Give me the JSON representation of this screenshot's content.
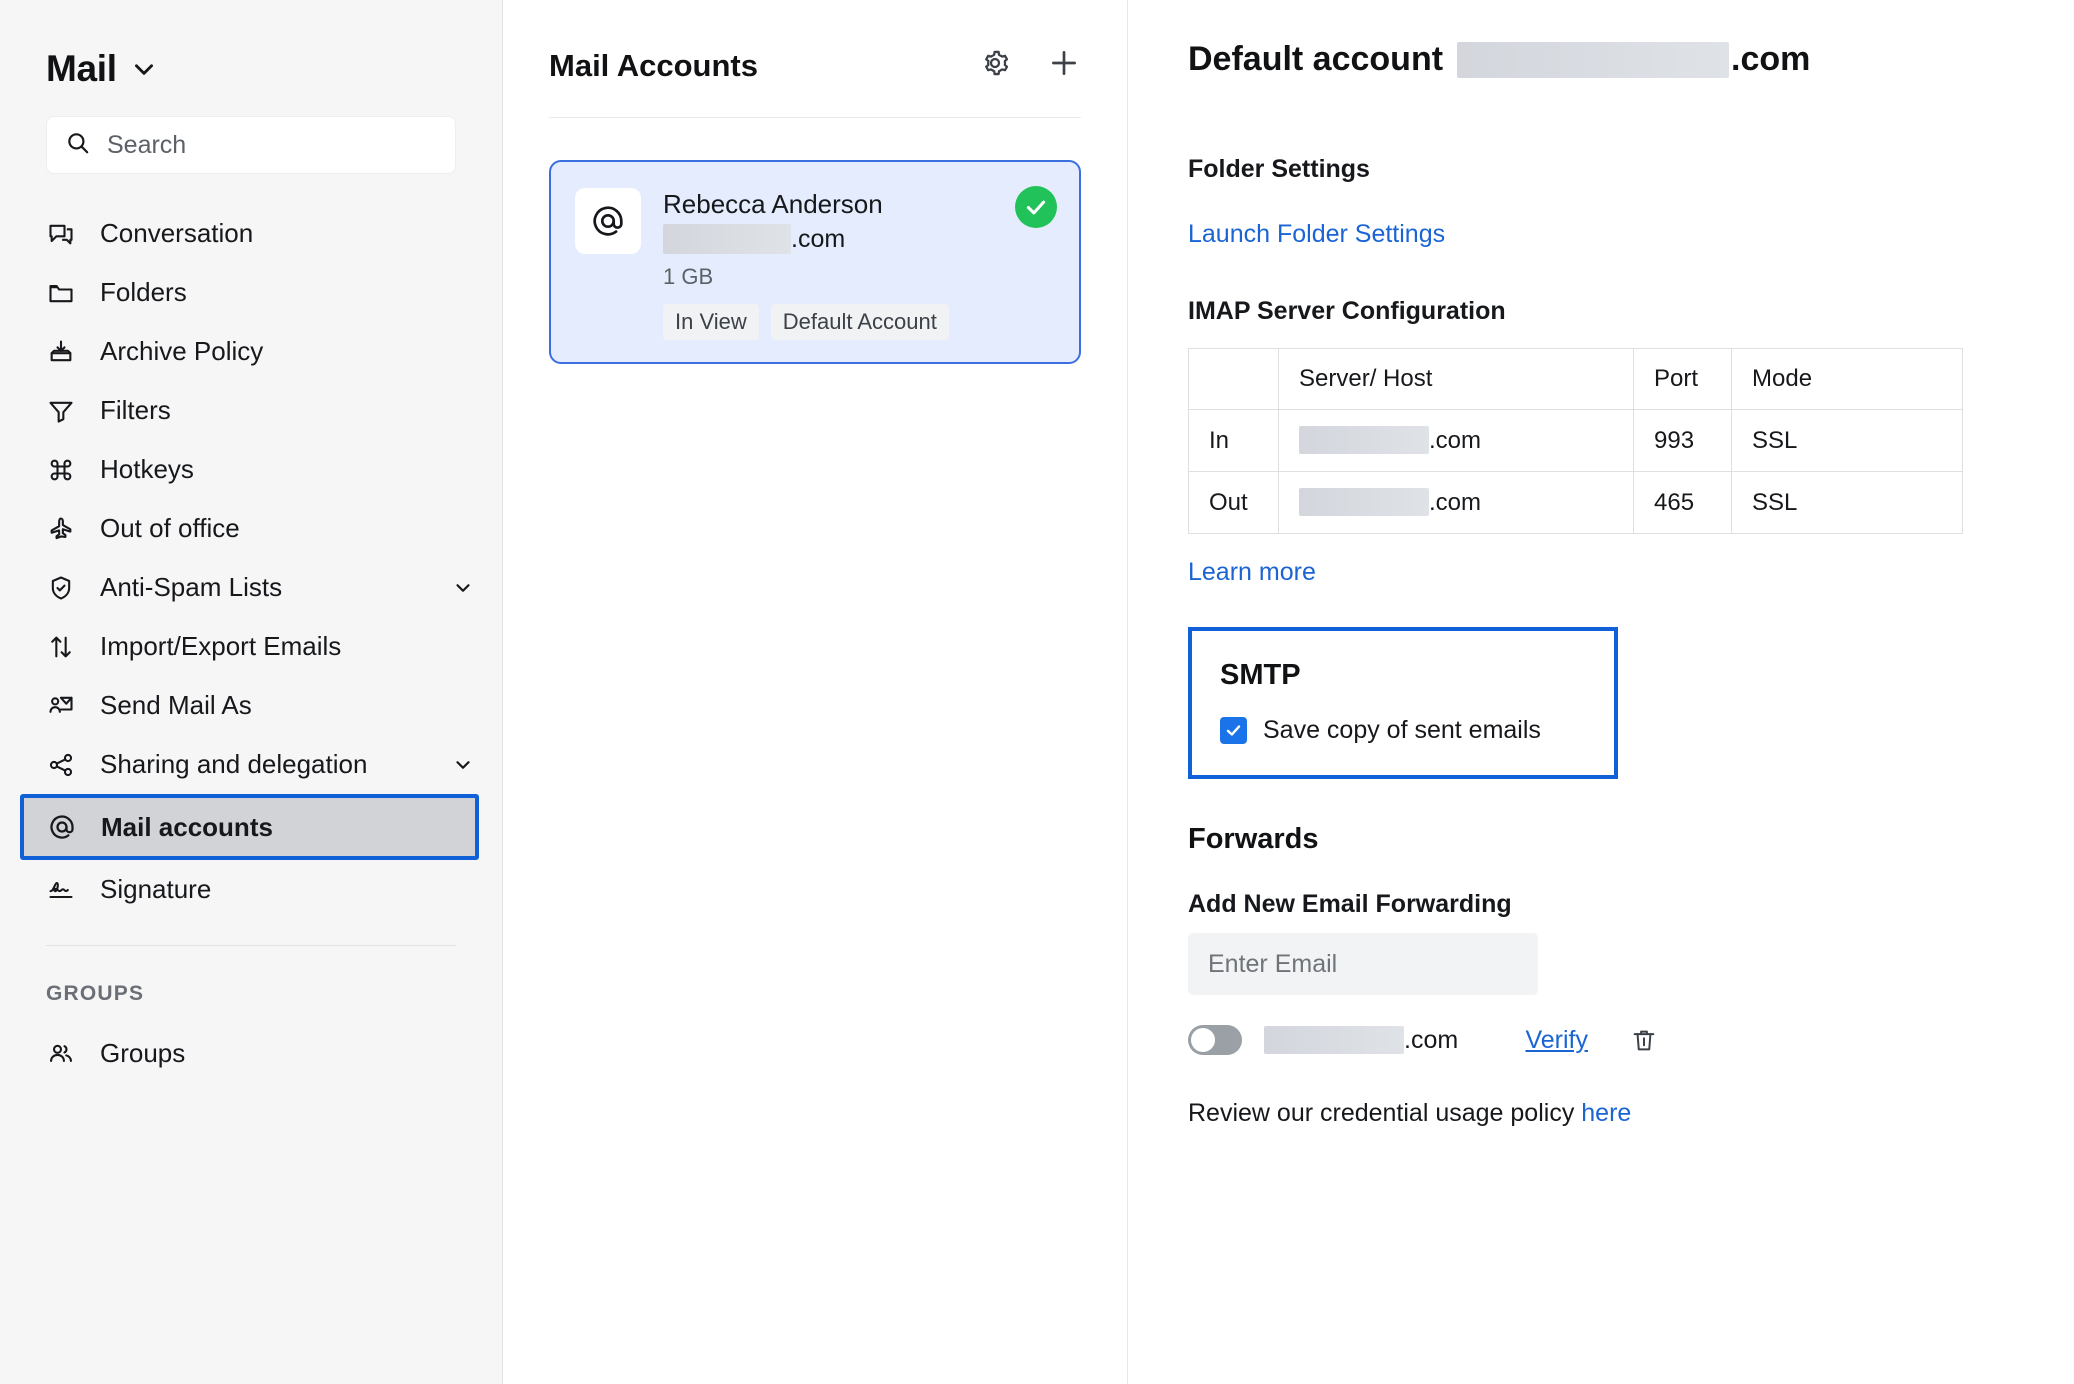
{
  "sidebar": {
    "brand": {
      "title": "Mail",
      "chevron_icon": "chevron-down-icon"
    },
    "search": {
      "placeholder": "Search",
      "icon": "search-icon"
    },
    "items": [
      {
        "label": "Conversation",
        "icon": "conversation-icon",
        "expandable": false
      },
      {
        "label": "Folders",
        "icon": "folder-icon",
        "expandable": false
      },
      {
        "label": "Archive Policy",
        "icon": "archive-icon",
        "expandable": false
      },
      {
        "label": "Filters",
        "icon": "filter-icon",
        "expandable": false
      },
      {
        "label": "Hotkeys",
        "icon": "command-icon",
        "expandable": false
      },
      {
        "label": "Out of office",
        "icon": "airplane-icon",
        "expandable": false
      },
      {
        "label": "Anti-Spam Lists",
        "icon": "shield-check-icon",
        "expandable": true
      },
      {
        "label": "Import/Export Emails",
        "icon": "arrows-up-down-icon",
        "expandable": false
      },
      {
        "label": "Send Mail As",
        "icon": "send-mail-as-icon",
        "expandable": false
      },
      {
        "label": "Sharing and delegation",
        "icon": "share-icon",
        "expandable": true
      },
      {
        "label": "Mail accounts",
        "icon": "at-sign-icon",
        "expandable": false,
        "selected": true
      },
      {
        "label": "Signature",
        "icon": "signature-icon",
        "expandable": false
      }
    ],
    "groups_heading": "GROUPS",
    "groups_items": [
      {
        "label": "Groups",
        "icon": "people-icon"
      }
    ]
  },
  "accounts_panel": {
    "title": "Mail Accounts",
    "settings_icon": "gear-icon",
    "add_icon": "plus-icon",
    "card": {
      "avatar_icon": "at-sign-icon",
      "name": "Rebecca Anderson",
      "email_redacted": true,
      "email_suffix": ".com",
      "storage": "1 GB",
      "tags": [
        "In View",
        "Default Account"
      ],
      "status_icon": "check-circle-icon",
      "status_color": "#21c25a"
    }
  },
  "detail": {
    "heading_prefix": "Default account",
    "heading_suffix": ".com",
    "folder_settings": {
      "title": "Folder Settings",
      "launch_link": "Launch Folder Settings"
    },
    "imap": {
      "title": "IMAP Server Configuration",
      "columns": [
        "",
        "Server/ Host",
        "Port",
        "Mode"
      ],
      "rows": [
        {
          "direction": "In",
          "host_suffix": ".com",
          "port": "993",
          "mode": "SSL"
        },
        {
          "direction": "Out",
          "host_suffix": ".com",
          "port": "465",
          "mode": "SSL"
        }
      ],
      "learn_more": "Learn more"
    },
    "smtp": {
      "title": "SMTP",
      "checkbox_label": "Save copy of sent emails",
      "checked": true,
      "highlight_color": "#1060d8"
    },
    "forwards": {
      "title": "Forwards",
      "add_label": "Add New Email Forwarding",
      "input_placeholder": "Enter Email",
      "input_value": "",
      "row": {
        "enabled": false,
        "email_suffix": ".com",
        "verify_label": "Verify",
        "delete_icon": "trash-icon"
      },
      "policy_text": "Review our credential usage policy",
      "policy_link": "here"
    }
  }
}
